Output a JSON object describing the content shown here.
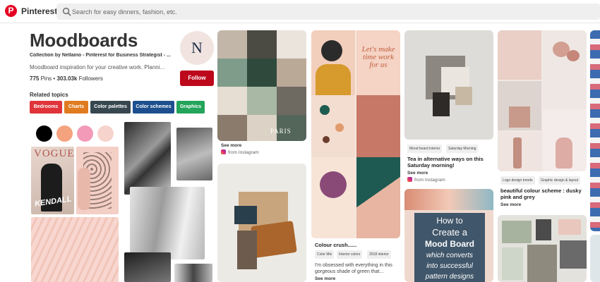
{
  "topbar": {
    "brand": "Pinterest",
    "search_placeholder": "Search for easy dinners, fashion, etc."
  },
  "board": {
    "title": "Moodboards",
    "collection": "Collection by Nellaino - Pinterest for Business Strategist - ...",
    "description": "Moodboard inspiration for your creative work. Planni...",
    "pins_count": "775",
    "pins_label": "Pins",
    "followers_count": "303.03k",
    "followers_label": "Followers",
    "avatar_letter": "N",
    "follow_label": "Follow"
  },
  "related": {
    "heading": "Related topics",
    "chips": [
      {
        "label": "Bedrooms",
        "color": "#e0343a"
      },
      {
        "label": "Charts",
        "color": "#e07b1f"
      },
      {
        "label": "Color palettes",
        "color": "#37474f"
      },
      {
        "label": "Color schemes",
        "color": "#1d4f8e"
      },
      {
        "label": "Graphics",
        "color": "#23a45a"
      }
    ]
  },
  "swatches": [
    "#000000",
    "#f5a27e",
    "#f29ab7",
    "#f6d3cc"
  ],
  "image_text": {
    "vogue": "VOGUE",
    "kendall": "KENDALL",
    "paris": "PARIS",
    "lets_make_time": "Let's make time work for us",
    "how_to": "How to",
    "create_a": "Create a",
    "mood_board": "Mood Board",
    "which_converts": "which converts",
    "into_successful": "into successful",
    "pattern_designs": "pattern designs"
  },
  "pins": {
    "pin1": {
      "see_more": "See more",
      "source": "from Instagram"
    },
    "pin3": {
      "title": "Colour crush......",
      "tags": [
        "Color Mix",
        "Interior colors",
        "2018 interior"
      ],
      "description": "I'm obsessed with everything in this gorgeous shade of green that...",
      "see_more": "See more"
    },
    "pin4": {
      "tags": [
        "Mood board interior",
        "Saturday Morning"
      ],
      "title": "Tea in alternative ways on this Saturday morning!",
      "see_more": "See more",
      "source": "from Instagram"
    },
    "pin5": {
      "tags": [
        "Logo design trends",
        "Graphic design & layout"
      ],
      "title": "beautiful colour scheme : dusky pink and grey",
      "see_more": "See more"
    }
  }
}
